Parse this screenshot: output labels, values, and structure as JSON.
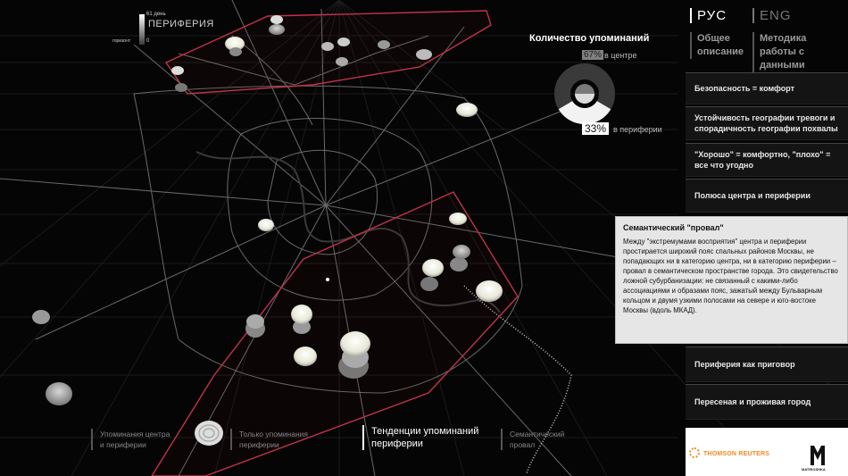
{
  "legend": {
    "max_label": "61 день",
    "title": "ПЕРИФЕРИЯ",
    "zero_label": "0",
    "axis_label": "горизонт"
  },
  "donut": {
    "title": "Количество упоминаний",
    "center_pct": "67%",
    "center_label": "в центре",
    "periphery_pct": "33%",
    "periphery_label": "в периферии",
    "center_fraction": 0.67,
    "periphery_fraction": 0.33
  },
  "language": {
    "ru": "РУС",
    "en": "ENG",
    "active": "ru"
  },
  "topnav": {
    "overview": "Общее\nописание",
    "method": "Методика\nработы с данными"
  },
  "menu": [
    "Безопасность = комфорт",
    "Устойчивость географии тревоги и спорадичность географии похвалы",
    "\"Хорошо\" = комфортно, \"плохо\" = все что угодно",
    "Полюса центра и периферии",
    "Периферия как приговор",
    "Пересеная и проживая город"
  ],
  "semantic_gap": {
    "heading": "Семантический \"провал\"",
    "text": "Между \"экстремумами восприятия\" центра и периферии простирается широкий пояс спальных районов Москвы, не попадающих ни в категорию центра, ни в категорию периферии – провал в семантическом пространстве города. Это свидетельство ложной субурбанизации: не связанный с какими-либо ассоциациями и образами пояс, зажатый между Бульварным кольцом и двумя узкими полосами на севере и юго-востоке Москвы (вдоль МКАД)."
  },
  "bottom_legend": {
    "both": "Упоминания центра\nи периферии",
    "only_periphery": "Только упоминания\nпериферии",
    "trends": "Тенденции упоминаний\nпериферии",
    "semantic": "Семантический\nпровал"
  },
  "logos": {
    "thomson": "THOMSON REUTERS",
    "matrioshka": "MATRIOSHKA"
  },
  "colors": {
    "background": "#050505",
    "zone_outline": "#c0334a",
    "accent_tr": "#f08a24"
  }
}
